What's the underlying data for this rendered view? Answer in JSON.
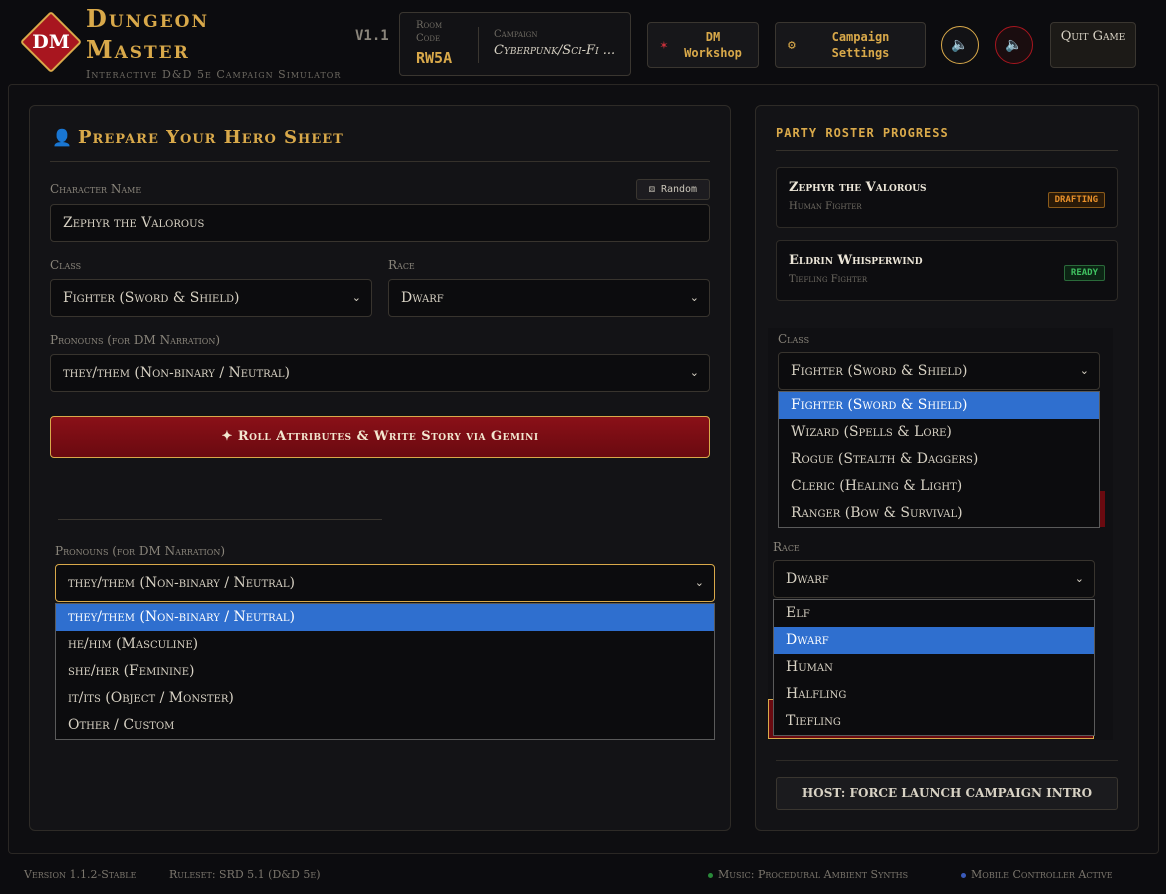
{
  "header": {
    "logo_text": "DM",
    "title_line1": "Dungeon",
    "title_line2": "Master",
    "subtitle": "Interactive D&D 5e Campaign Simulator",
    "version": "V1.1",
    "room_label": "Room Code",
    "room_code": "RW5A",
    "campaign_label": "Campaign",
    "campaign_value": "Cyberpunk/Sci-Fi ...",
    "dm_workshop": "DM Workshop",
    "campaign_settings": "Campaign Settings",
    "quit": "Quit Game"
  },
  "hero": {
    "title": "Prepare Your Hero Sheet",
    "name_label": "Character Name",
    "random_label": "Random",
    "name_value": "Zephyr the Valorous",
    "class_label": "Class",
    "class_value": "Fighter (Sword & Shield)",
    "race_label": "Race",
    "race_value": "Dwarf",
    "pronouns_label": "Pronouns (for DM Narration)",
    "pronouns_value": "they/them (Non-binary / Neutral)",
    "roll_button": "Roll Attributes & Write Story via Gemini"
  },
  "pronoun_dropdown": {
    "label": "Pronouns (for DM Narration)",
    "value": "they/them (Non-binary / Neutral)",
    "options": [
      "they/them (Non-binary / Neutral)",
      "he/him (Masculine)",
      "she/her (Feminine)",
      "it/its (Object / Monster)",
      "Other / Custom"
    ]
  },
  "roster": {
    "title": "PARTY ROSTER PROGRESS",
    "cards": [
      {
        "name": "Zephyr the Valorous",
        "sub": "Human Fighter",
        "badge": "DRAFTING"
      },
      {
        "name": "Eldrin Whisperwind",
        "sub": "Tiefling Fighter",
        "badge": "READY"
      }
    ]
  },
  "class_dropdown": {
    "label": "Class",
    "value": "Fighter (Sword & Shield)",
    "options": [
      "Fighter (Sword & Shield)",
      "Wizard (Spells & Lore)",
      "Rogue (Stealth & Daggers)",
      "Cleric (Healing & Light)",
      "Ranger (Bow & Survival)"
    ]
  },
  "race_dropdown": {
    "label": "Race",
    "value": "Dwarf",
    "options": [
      "Elf",
      "Dwarf",
      "Human",
      "Halfling",
      "Tiefling"
    ]
  },
  "host_button": "HOST: FORCE LAUNCH CAMPAIGN INTRO",
  "footer": {
    "version": "Version 1.1.2-Stable",
    "ruleset": "Ruleset: SRD 5.1 (D&D 5e)",
    "music": "Music: Procedural Ambient Synths",
    "mobile": "Mobile Controller Active"
  },
  "colors": {
    "accent_gold": "#d9a94a",
    "danger_red": "#a8161f",
    "select_blue": "#2f6fcf",
    "music_dot": "#2a8a3a",
    "mobile_dot": "#3a5aba"
  }
}
